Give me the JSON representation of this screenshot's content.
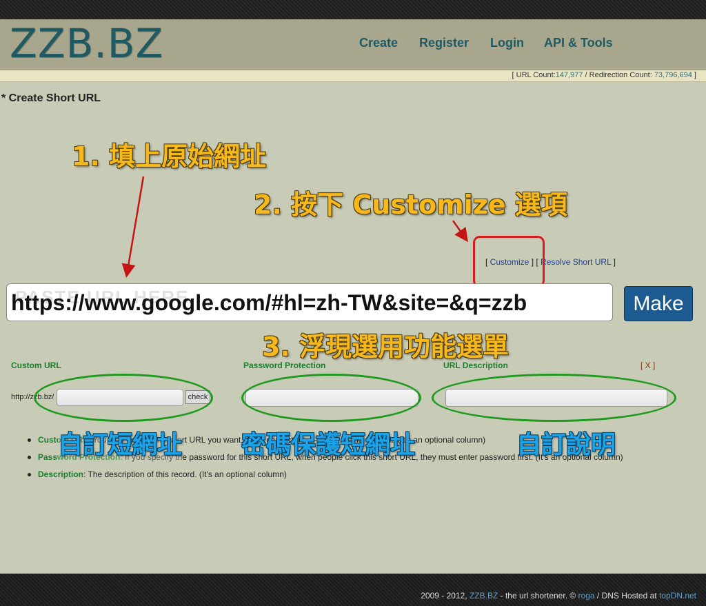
{
  "header": {
    "logo": "ZZB.BZ",
    "nav": [
      "Create",
      "Register",
      "Login",
      "API & Tools"
    ]
  },
  "stats": {
    "url_count_label": "URL Count:",
    "url_count": "147,977",
    "redirection_label": "Redirection Count:",
    "redirection_count": "73,796,694"
  },
  "page_title": "* Create Short URL",
  "annotations": {
    "step1": "1. 填上原始網址",
    "step2": "2. 按下 Customize 選項",
    "step3": "3. 浮現選用功能選單",
    "custom_url": "自訂短網址",
    "password": "密碼保護短網址",
    "description": "自訂說明"
  },
  "links": {
    "customize": "Customize",
    "resolve": "Resolve Short URL"
  },
  "url_input": {
    "placeholder": "PASTE URL HERE",
    "value": "https://www.google.com/#hl=zh-TW&site=&q=zzb"
  },
  "make_button": "Make",
  "options": {
    "custom_url_label": "Custom URL",
    "password_label": "Password Protection",
    "description_label": "URL Description",
    "close_label": "[ X ]",
    "prefix": "http://zzb.bz/",
    "check_button": "check"
  },
  "help": [
    {
      "term": "Custom URL",
      "text": ": You may specify the short URL you want, 4~16 characters, a-z, 0-9, _ and - permit. (It's an optional column)"
    },
    {
      "term": "Password Protection",
      "text": ": If you specify the password for this short URL, when people click this short URL, they must enter password first. (It's an optional column)"
    },
    {
      "term": "Description",
      "text": ": The description of this record. (It's an optional column)"
    }
  ],
  "footer": {
    "prefix": "2009 - 2012,",
    "site": "ZZB.BZ",
    "mid": "- the url shortener. ©",
    "author": "roga",
    "hosted": "/ DNS Hosted at",
    "host": "topDN.net"
  },
  "colors": {
    "background": "#c8ccb7",
    "header": "#a8a68c",
    "brand": "#1f5a63",
    "section_green": "#1b7c2e",
    "annotation_orange": "#f7b81b",
    "annotation_blue": "#1aa3e8",
    "highlight_red": "#d21e1e",
    "make_button": "#1c5a8f"
  }
}
